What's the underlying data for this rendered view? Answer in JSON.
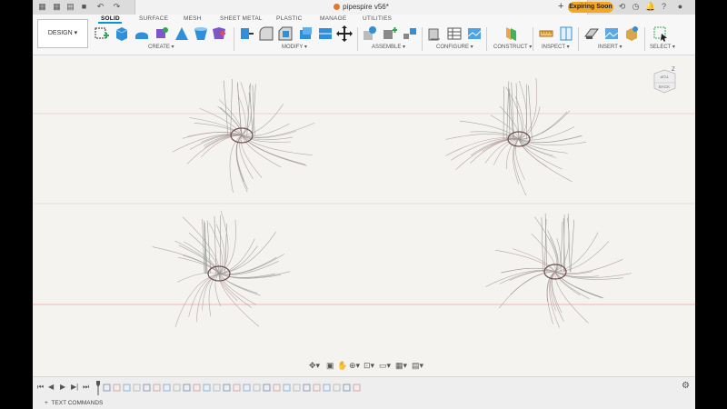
{
  "app": {
    "document_title": "pipespire v56*",
    "expiring_label": "Expiring Soon",
    "accent": "#0696d7"
  },
  "ribbon": {
    "workspace": "DESIGN",
    "tabs": [
      {
        "label": "SOLID",
        "active": true
      },
      {
        "label": "SURFACE",
        "active": false
      },
      {
        "label": "MESH",
        "active": false
      },
      {
        "label": "SHEET METAL",
        "active": false
      },
      {
        "label": "PLASTIC",
        "active": false
      },
      {
        "label": "MANAGE",
        "active": false
      },
      {
        "label": "UTILITIES",
        "active": false
      }
    ],
    "groups": {
      "create": "CREATE ▾",
      "modify": "MODIFY ▾",
      "assemble": "ASSEMBLE ▾",
      "configure": "CONFIGURE ▾",
      "construct": "CONSTRUCT ▾",
      "inspect": "INSPECT ▾",
      "insert": "INSERT ▾",
      "select": "SELECT ▾"
    }
  },
  "viewcube": {
    "top": "TOP",
    "front": "BACK",
    "axis_z": "Z",
    "axis_x": "X"
  },
  "status": {
    "text_commands": "TEXT COMMANDS"
  }
}
